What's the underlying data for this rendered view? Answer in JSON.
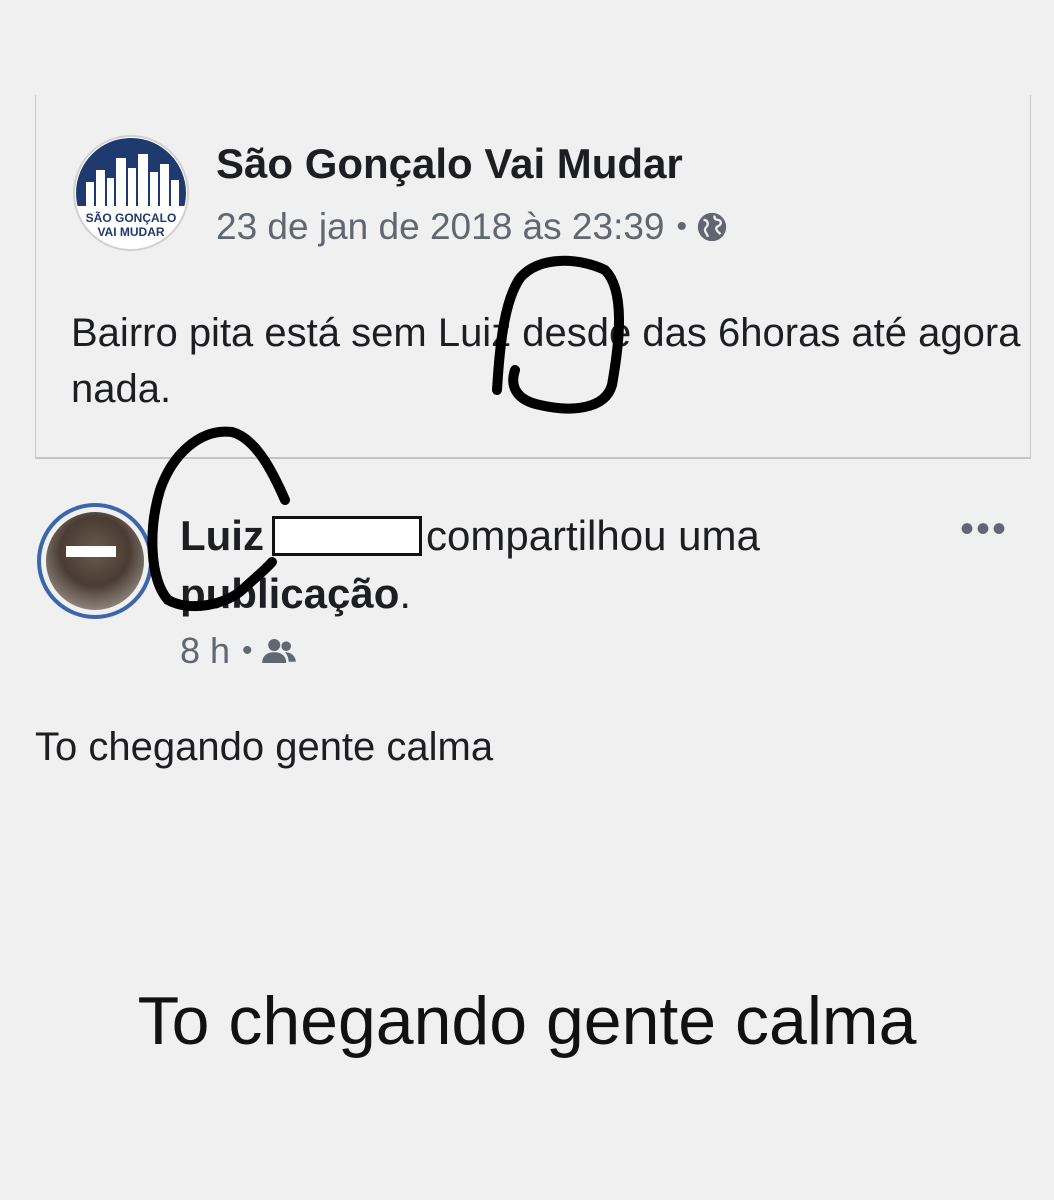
{
  "shared_post": {
    "page_name": "São Gonçalo Vai Mudar",
    "logo_text_line1": "SÃO GONÇALO",
    "logo_text_line2": "VAI MUDAR",
    "timestamp": "23 de jan de 2018 às 23:39",
    "separator": "•",
    "privacy_icon": "globe-icon",
    "text": "Bairro pita está sem Luiz desde das 6horas até agora nada."
  },
  "share_header": {
    "user_first_name": "Luiz",
    "action_text": "compartilhou uma",
    "object_text": "publicação",
    "end_punct": ".",
    "more_label": "•••",
    "time": "8 h",
    "separator": "•",
    "audience_icon": "friends-icon"
  },
  "share_text": "To chegando gente calma",
  "caption": "To chegando gente calma",
  "colors": {
    "background": "#f0f0f0",
    "avatar_ring": "#3b66ab",
    "logo_navy": "#1f3a6e",
    "meta_gray": "#606770"
  }
}
